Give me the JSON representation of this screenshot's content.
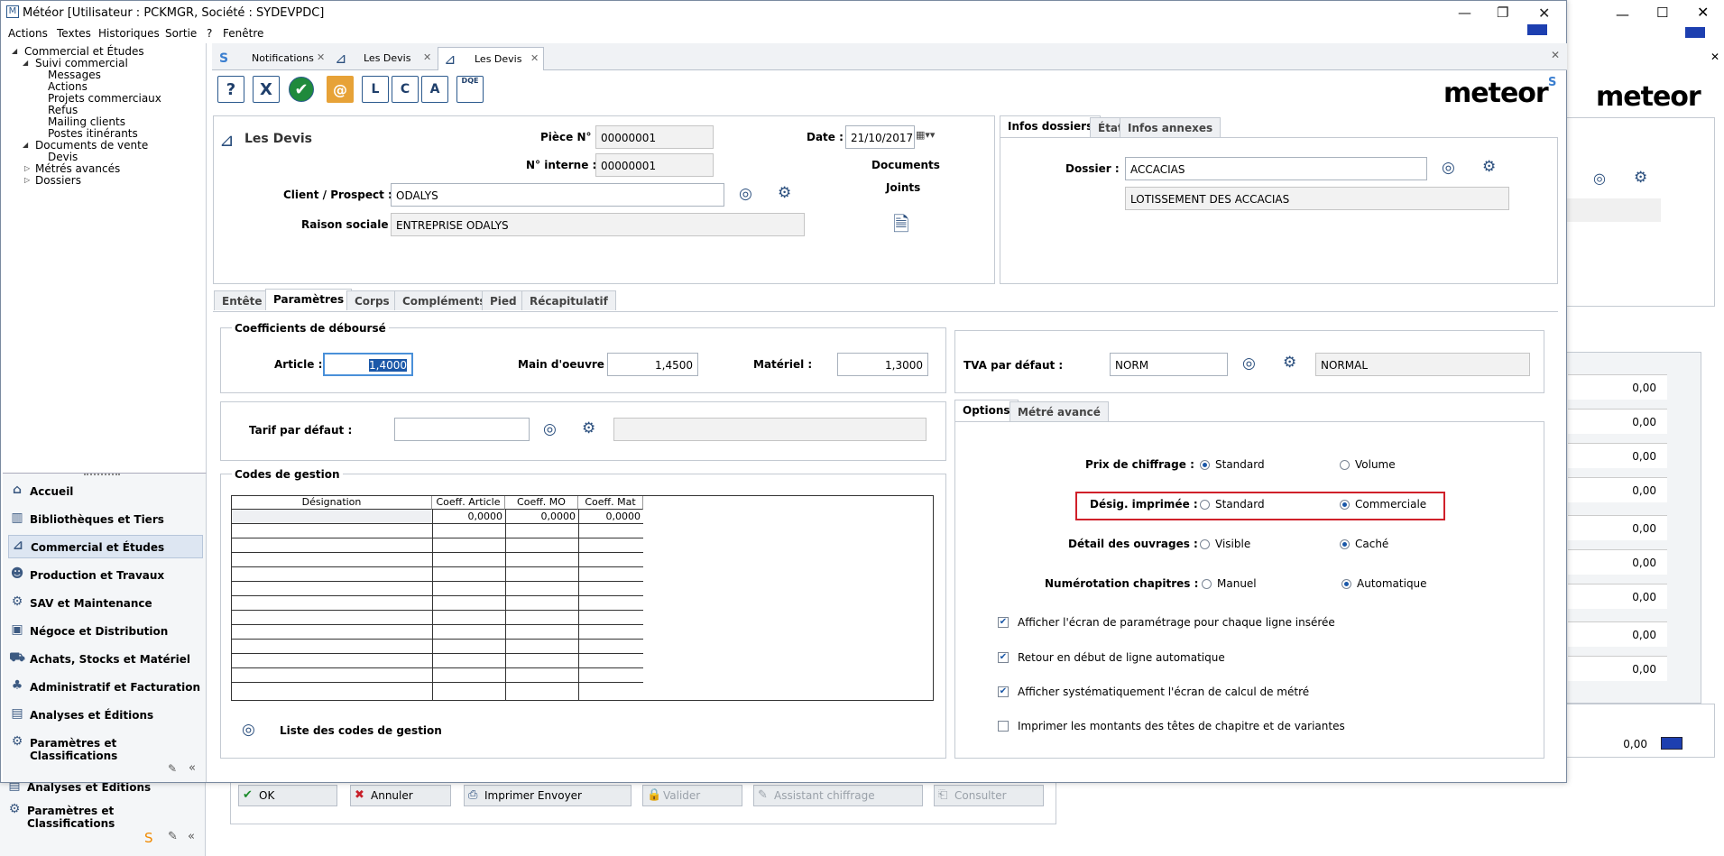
{
  "window": {
    "title": "Météor [Utilisateur : PCKMGR, Société : SYDEVPDC]"
  },
  "menu": [
    "Actions",
    "Textes",
    "Historiques",
    "Sortie",
    "?",
    "Fenêtre"
  ],
  "tree": {
    "root": "Commercial et Études",
    "suivi": "Suivi commercial",
    "suivi_items": [
      "Messages",
      "Actions",
      "Projets commerciaux",
      "Refus",
      "Mailing clients",
      "Postes itinérants"
    ],
    "documents": "Documents de vente",
    "documents_items": [
      "Devis"
    ],
    "metres": "Métrés avancés",
    "dossiers": "Dossiers"
  },
  "nav": [
    "Accueil",
    "Bibliothèques et Tiers",
    "Commercial et Études",
    "Production et Travaux",
    "SAV et Maintenance",
    "Négoce et Distribution",
    "Achats, Stocks et Matériel",
    "Administratif et Facturation",
    "Analyses et Éditions",
    "Paramètres et Classifications"
  ],
  "nav_under": [
    "Analyses et Éditions",
    "Paramètres et Classifications"
  ],
  "doc_tabs": [
    "Notifications",
    "Les Devis",
    "Les Devis"
  ],
  "toolbar": {
    "help": "?",
    "cancel": "X",
    "ok": "✔",
    "l": "L",
    "c": "C",
    "a": "A",
    "dqe": "DQE"
  },
  "logo": "meteor",
  "header": {
    "doc_title": "Les Devis",
    "piece_label": "Pièce N° :",
    "piece_value": "00000001",
    "interne_label": "N° interne :",
    "interne_value": "00000001",
    "date_label": "Date :",
    "date_value": "21/10/2017",
    "client_label": "Client / Prospect :",
    "client_value": "ODALYS",
    "raison_label": "Raison sociale :",
    "raison_value": "ENTREPRISE ODALYS",
    "docs_label": "Documents",
    "joints_label": "Joints"
  },
  "infos": {
    "tabs": [
      "Infos dossiers",
      "État",
      "Infos annexes"
    ],
    "dossier_label": "Dossier :",
    "dossier_value": "ACCACIAS",
    "dossier_desc": "LOTISSEMENT DES ACCACIAS"
  },
  "main_tabs": [
    "Entête",
    "Paramètres",
    "Corps",
    "Compléments",
    "Pied",
    "Récapitulatif"
  ],
  "coeff": {
    "title": "Coefficients de déboursé",
    "article_label": "Article :",
    "article_value": "1,4000",
    "mo_label": "Main d'oeuvre :",
    "mo_value": "1,4500",
    "mat_label": "Matériel :",
    "mat_value": "1,3000"
  },
  "tarif": {
    "label": "Tarif par défaut :",
    "value": "",
    "desc": ""
  },
  "codes": {
    "title": "Codes de gestion",
    "columns": [
      "Désignation",
      "Coeff. Article",
      "Coeff. MO",
      "Coeff. Mat"
    ],
    "row1": [
      "",
      "0,0000",
      "0,0000",
      "0,0000"
    ],
    "link": "Liste des codes de gestion"
  },
  "tva": {
    "label": "TVA par défaut :",
    "code": "NORM",
    "desc": "NORMAL"
  },
  "options": {
    "tabs": [
      "Options",
      "Métré avancé"
    ],
    "prix_label": "Prix de chiffrage :",
    "prix_opts": [
      "Standard",
      "Volume"
    ],
    "desig_label": "Désig. imprimée :",
    "desig_opts": [
      "Standard",
      "Commerciale"
    ],
    "detail_label": "Détail des ouvrages :",
    "detail_opts": [
      "Visible",
      "Caché"
    ],
    "numero_label": "Numérotation chapitres :",
    "numero_opts": [
      "Manuel",
      "Automatique"
    ],
    "checks": [
      "Afficher l'écran de paramétrage pour chaque ligne insérée",
      "Retour en début de ligne automatique",
      "Afficher systématiquement l'écran de calcul de métré",
      "Imprimer les montants des têtes de chapitre et de variantes"
    ]
  },
  "bottom_buttons": [
    "OK",
    "Annuler",
    "Imprimer Envoyer",
    "Valider",
    "Assistant chiffrage",
    "Consulter"
  ],
  "bg_values": [
    "0,00",
    "0,00",
    "0,00",
    "0,00",
    "0,00",
    "0,00",
    "0,00",
    "0,00",
    "0,00",
    "0,00"
  ],
  "bg_logo": "meteor",
  "colors": {
    "accent": "#1b58a8",
    "highlight_box": "#d0202a"
  }
}
